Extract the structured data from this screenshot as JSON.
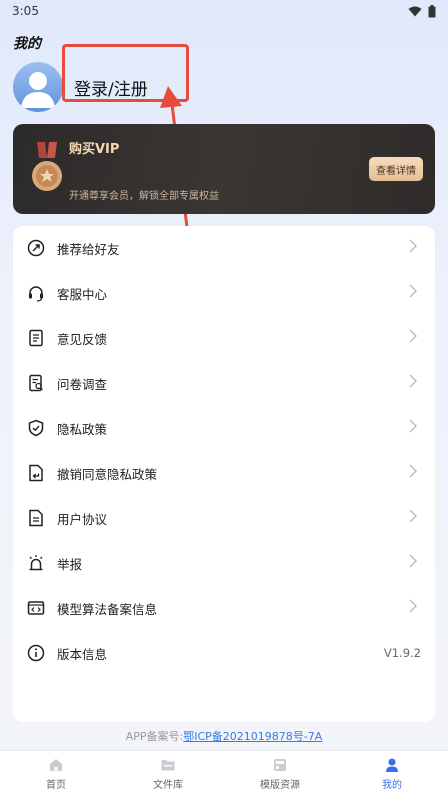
{
  "status_bar": {
    "time": "3:05"
  },
  "header": {
    "title": "我的"
  },
  "profile": {
    "login_label": "登录/注册"
  },
  "vip": {
    "title": "购买VIP",
    "subtitle": "开通尊享会员，解锁全部专属权益",
    "button_label": "查看详情"
  },
  "menu": {
    "items": [
      {
        "label": "推荐给好友",
        "icon": "share-icon"
      },
      {
        "label": "客服中心",
        "icon": "headset-icon"
      },
      {
        "label": "意见反馈",
        "icon": "feedback-icon"
      },
      {
        "label": "问卷调查",
        "icon": "survey-icon"
      },
      {
        "label": "隐私政策",
        "icon": "shield-icon"
      },
      {
        "label": "撤销同意隐私政策",
        "icon": "revoke-icon"
      },
      {
        "label": "用户协议",
        "icon": "document-icon"
      },
      {
        "label": "举报",
        "icon": "alarm-icon"
      },
      {
        "label": "模型算法备案信息",
        "icon": "code-icon"
      },
      {
        "label": "版本信息",
        "icon": "info-icon",
        "value": "V1.9.2"
      }
    ]
  },
  "footer": {
    "record_prefix": "APP备案号:",
    "record_link": "鄂ICP备2021019878号-7A"
  },
  "tabbar": {
    "tabs": [
      {
        "label": "首页",
        "icon": "home-icon"
      },
      {
        "label": "文件库",
        "icon": "folder-icon"
      },
      {
        "label": "模版资源",
        "icon": "template-icon"
      },
      {
        "label": "我的",
        "icon": "user-icon"
      }
    ],
    "active_index": 3
  },
  "colors": {
    "accent": "#3a6ee8",
    "annotation": "#e64b3b",
    "vip_gold": "#f6d9b0"
  }
}
